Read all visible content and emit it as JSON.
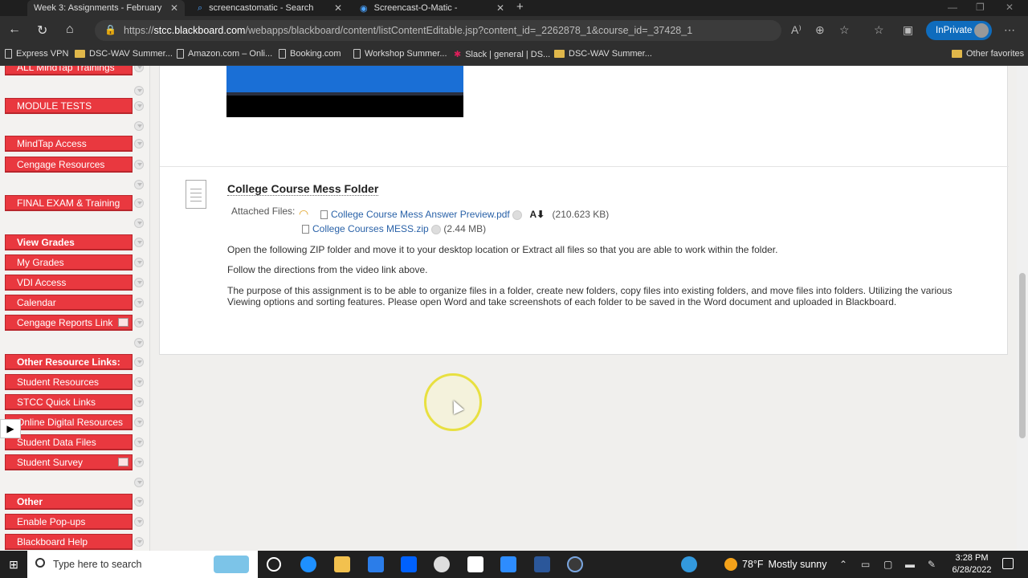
{
  "browser": {
    "tabs": [
      {
        "title": "Week 3: Assignments - February",
        "active": true
      },
      {
        "title": "screencastomatic - Search",
        "active": false
      },
      {
        "title": "Screencast-O-Matic -",
        "active": false
      }
    ],
    "url_domain": "stcc.blackboard.com",
    "url_prefix": "https://",
    "url_path": "/webapps/blackboard/content/listContentEditable.jsp?content_id=_2262878_1&course_id=_37428_1",
    "inprivate_label": "InPrivate",
    "bookmarks": [
      {
        "label": "Express VPN",
        "icon": "page-icon"
      },
      {
        "label": "DSC-WAV Summer...",
        "icon": "folder-icon"
      },
      {
        "label": "Amazon.com – Onli...",
        "icon": "page-icon"
      },
      {
        "label": "Booking.com",
        "icon": "page-icon"
      },
      {
        "label": "Workshop Summer...",
        "icon": "page-icon"
      },
      {
        "label": "Slack | general | DS...",
        "icon": "slack-icon"
      },
      {
        "label": "DSC-WAV Summer...",
        "icon": "folder-icon"
      }
    ],
    "other_favorites": "Other favorites"
  },
  "sidebar": {
    "items": [
      {
        "label": "ALL MindTap Trainings",
        "header": false
      },
      {
        "label": "MODULE TESTS",
        "header": false
      },
      {
        "label": "MindTap Access",
        "header": false
      },
      {
        "label": "Cengage Resources",
        "header": false
      },
      {
        "label": "FINAL EXAM & Training",
        "header": false
      },
      {
        "label": "View Grades",
        "header": true
      },
      {
        "label": "My Grades",
        "header": false
      },
      {
        "label": "VDI Access",
        "header": false
      },
      {
        "label": "Calendar",
        "header": false
      },
      {
        "label": "Cengage Reports Link",
        "header": false
      },
      {
        "label": "Other Resource Links:",
        "header": true
      },
      {
        "label": "Student Resources",
        "header": false
      },
      {
        "label": "STCC Quick Links",
        "header": false
      },
      {
        "label": "Online Digital Resources",
        "header": false
      },
      {
        "label": "Student Data Files",
        "header": false
      },
      {
        "label": "Student Survey",
        "header": false
      },
      {
        "label": "Other",
        "header": true
      },
      {
        "label": "Enable Pop-ups",
        "header": false
      },
      {
        "label": "Blackboard Help",
        "header": false
      }
    ]
  },
  "content": {
    "item_title": "College Course Mess Folder",
    "attached_label": "Attached Files:",
    "files": [
      {
        "name": "College Course Mess Answer Preview.pdf",
        "size": "(210.623 KB)"
      },
      {
        "name": "College Courses MESS.zip",
        "size": "(2.44 MB)"
      }
    ],
    "paragraphs": [
      "Open the following ZIP folder and move it to your desktop location or Extract all files so that you are able to work within the folder.",
      "Follow the directions from the video link above.",
      "The purpose of this assignment is to be able to organize files in a folder, create new folders, copy files into existing folders, and move files into folders. Utilizing the various",
      "Viewing options and sorting features. Please open Word and take screenshots of each folder to be saved in the Word document and uploaded in Blackboard."
    ]
  },
  "taskbar": {
    "search_placeholder": "Type here to search",
    "weather_temp": "78°F",
    "weather_desc": "Mostly sunny",
    "time": "3:28 PM",
    "date": "6/28/2022"
  },
  "colors": {
    "sidebar_button": "#e9383f",
    "link": "#2a62a8",
    "inprivate": "#0f6cbd"
  }
}
